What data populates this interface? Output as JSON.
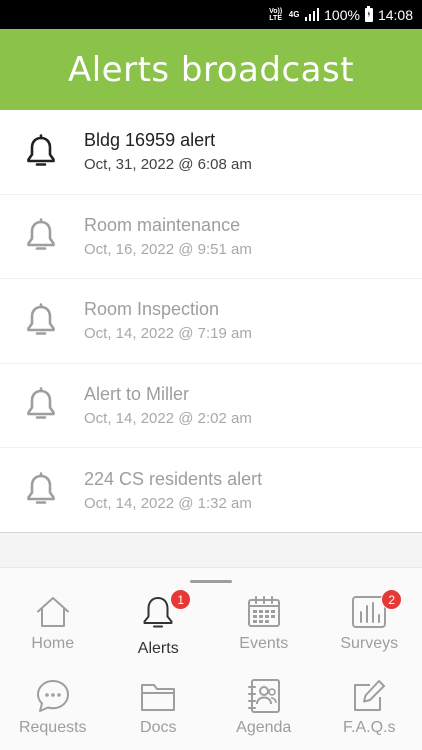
{
  "status_bar": {
    "volte": "Vo))\nLTE",
    "network": "4G",
    "battery": "100%",
    "time": "14:08"
  },
  "header": {
    "title": "Alerts broadcast",
    "color": "#8bc34a"
  },
  "alerts": [
    {
      "title": "Bldg 16959 alert",
      "date": "Oct, 31, 2022 @ 6:08 am",
      "state": "unread"
    },
    {
      "title": "Room maintenance",
      "date": "Oct, 16, 2022 @ 9:51 am",
      "state": "read"
    },
    {
      "title": "Room Inspection",
      "date": "Oct, 14, 2022 @ 7:19 am",
      "state": "read"
    },
    {
      "title": "Alert to Miller",
      "date": "Oct, 14, 2022 @ 2:02 am",
      "state": "read"
    },
    {
      "title": "224 CS residents alert",
      "date": "Oct, 14, 2022 @ 1:32 am",
      "state": "read"
    }
  ],
  "nav": {
    "items": [
      {
        "label": "Home",
        "icon": "home-icon"
      },
      {
        "label": "Alerts",
        "icon": "bell-icon",
        "badge": "1",
        "active": true
      },
      {
        "label": "Events",
        "icon": "calendar-icon"
      },
      {
        "label": "Surveys",
        "icon": "bar-chart-icon",
        "badge": "2"
      },
      {
        "label": "Requests",
        "icon": "chat-bubble-icon"
      },
      {
        "label": "Docs",
        "icon": "folder-icon"
      },
      {
        "label": "Agenda",
        "icon": "contact-book-icon"
      },
      {
        "label": "F.A.Q.s",
        "icon": "edit-icon"
      }
    ]
  }
}
